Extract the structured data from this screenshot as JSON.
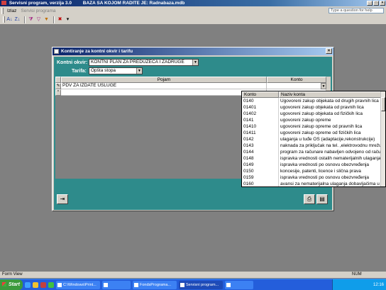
{
  "app": {
    "title": "Servisni program, verzija 3.0",
    "title_db": "BAZA SA KOJOM RADITE JE: Radnabaza.mdb",
    "window_buttons": [
      "_",
      "□",
      "×"
    ]
  },
  "menu": {
    "items": [
      {
        "label": "Izlaz",
        "enabled": true
      },
      {
        "label": "Servisi programa",
        "enabled": false
      }
    ],
    "help_placeholder": "Type a question for help"
  },
  "toolbar": {
    "icons": [
      "sort-ascending-icon",
      "sort-descending-icon",
      "filter-selection-icon",
      "filter-form-icon",
      "apply-filter-icon",
      "delete-record-icon",
      "dropdown-arrow-icon"
    ]
  },
  "dialog": {
    "title": "Kontiranje za kontni okvir i tarifu",
    "kontni_okvir_label": "Kontni okvir:",
    "kontni_okvir_value": "KONTNI PLAN ZA PREDUZEĆA I ZADRUGE",
    "tarifa_label": "Tarifa:",
    "tarifa_value": "Opšta stopa",
    "grid": {
      "columns": [
        "Pojam",
        "Konto"
      ],
      "rows": [
        {
          "selector": "✎",
          "pojam": "PDV ZA IZDATE USLUGE",
          "konto": ""
        },
        {
          "selector": "*",
          "pojam": "",
          "konto": ""
        }
      ]
    },
    "buttons": {
      "exit": "exit-door-icon",
      "print": "printer-icon",
      "preview": "print-preview-icon"
    }
  },
  "dropdown": {
    "columns": [
      "Konto",
      "Naziv konta"
    ],
    "rows": [
      {
        "code": "0140",
        "name": "Ugovoreni zakup objekata od drugih pravnih lica"
      },
      {
        "code": "01401",
        "name": "ugovoreni zakup objekata od pravnih lica"
      },
      {
        "code": "01402",
        "name": "ugovoreni zakup objekata od fizičkih lica"
      },
      {
        "code": "0141",
        "name": "ugovoreni zakup opreme"
      },
      {
        "code": "01410",
        "name": "ugovoreni zakup opreme od pravnih lica"
      },
      {
        "code": "01411",
        "name": "ugovoreni zakup opreme od fizičkih lica"
      },
      {
        "code": "0142",
        "name": "ulaganja u tuđe OS (adaptacije,rekonstrukcije)"
      },
      {
        "code": "0143",
        "name": "naknada za priključak na tel. ,elektrovodnu mrežu"
      },
      {
        "code": "0144",
        "name": "program za računare nabavljen odvojeno od računara"
      },
      {
        "code": "0148",
        "name": "ispravka vrednosti ostalih nematerijalnih ulaganja"
      },
      {
        "code": "0149",
        "name": "ispravka vrednosti po osnovu obezvređenja"
      },
      {
        "code": "0150",
        "name": "koncesije, patenti, licence i slična prava"
      },
      {
        "code": "0159",
        "name": "ispravka vrednosti po osnovu obezvređenja"
      },
      {
        "code": "0160",
        "name": "avansi za nematerijalna ulaganja dobavljačima u zemlji"
      }
    ]
  },
  "statusbar": {
    "left": "Form View",
    "num": "NUM"
  },
  "taskbar": {
    "start": "Start",
    "tasks": [
      {
        "label": "C:\\Windows\\Print...",
        "active": false
      },
      {
        "label": "",
        "active": false
      },
      {
        "label": "FondsPrograma...",
        "active": false
      },
      {
        "label": "Servisni program...",
        "active": true
      },
      {
        "label": "",
        "active": false
      }
    ],
    "clock": "12:16"
  },
  "colors": {
    "dialog_body": "#2e8b8b",
    "titlebar": "#0a246a",
    "taskbar": "#245edb",
    "start_button": "#3c9a3c"
  }
}
